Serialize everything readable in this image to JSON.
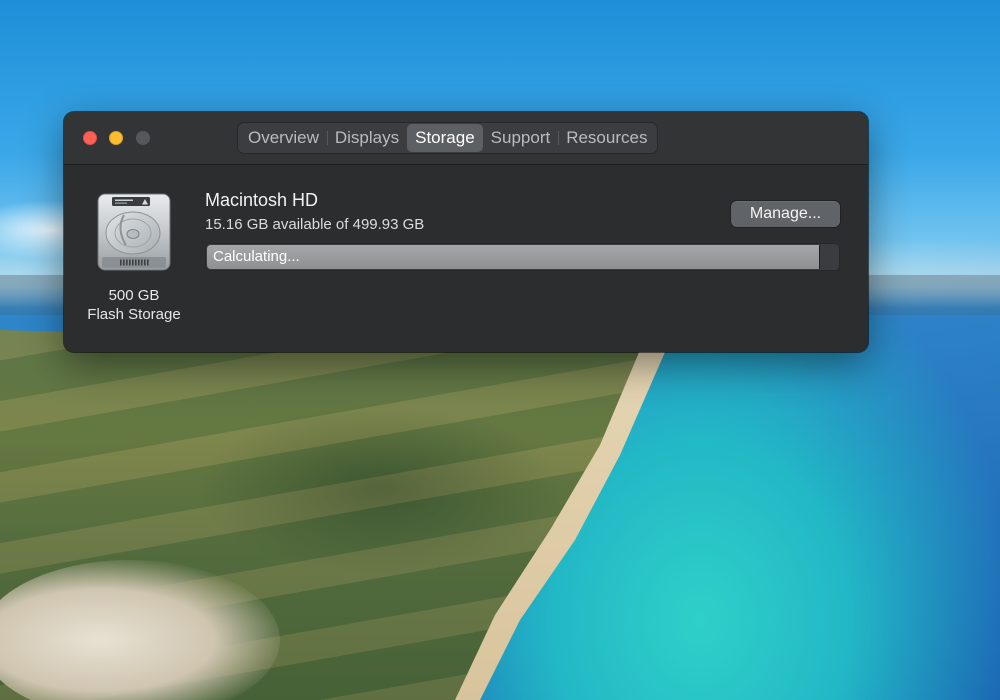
{
  "window": {
    "tabs": [
      {
        "label": "Overview",
        "active": false
      },
      {
        "label": "Displays",
        "active": false
      },
      {
        "label": "Storage",
        "active": true
      },
      {
        "label": "Support",
        "active": false
      },
      {
        "label": "Resources",
        "active": false
      }
    ]
  },
  "storage": {
    "drive": {
      "icon": "hard-drive-icon",
      "capacity": "500 GB",
      "type": "Flash Storage"
    },
    "volume": {
      "name": "Macintosh HD",
      "available": "15.16 GB available of 499.93 GB",
      "status": "Calculating...",
      "used_fraction": 0.97
    },
    "manage_label": "Manage..."
  },
  "colors": {
    "close": "#ff5f57",
    "minimize": "#febc2e",
    "zoom_inactive": "#55575a",
    "window_bg": "#2b2d2f",
    "bar_fill": "#9a9c9e"
  }
}
